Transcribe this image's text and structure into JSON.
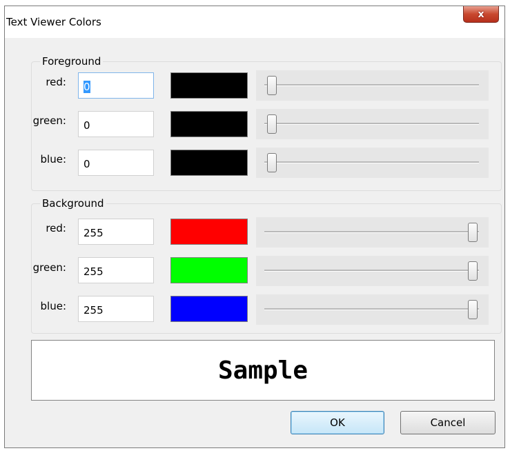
{
  "window": {
    "title": "Text Viewer Colors",
    "close_glyph": "x"
  },
  "foreground": {
    "legend": "Foreground",
    "rows": [
      {
        "label": "red:",
        "value": "0",
        "swatch_color": "#000000",
        "slider_fraction": 0
      },
      {
        "label": "green:",
        "value": "0",
        "swatch_color": "#000000",
        "slider_fraction": 0
      },
      {
        "label": "blue:",
        "value": "0",
        "swatch_color": "#000000",
        "slider_fraction": 0
      }
    ]
  },
  "background": {
    "legend": "Background",
    "rows": [
      {
        "label": "red:",
        "value": "255",
        "swatch_color": "#ff0000",
        "slider_fraction": 1
      },
      {
        "label": "green:",
        "value": "255",
        "swatch_color": "#00ff00",
        "slider_fraction": 1
      },
      {
        "label": "blue:",
        "value": "255",
        "swatch_color": "#0000ff",
        "slider_fraction": 1
      }
    ]
  },
  "preview": {
    "text": "Sample"
  },
  "buttons": {
    "ok": "OK",
    "cancel": "Cancel"
  }
}
